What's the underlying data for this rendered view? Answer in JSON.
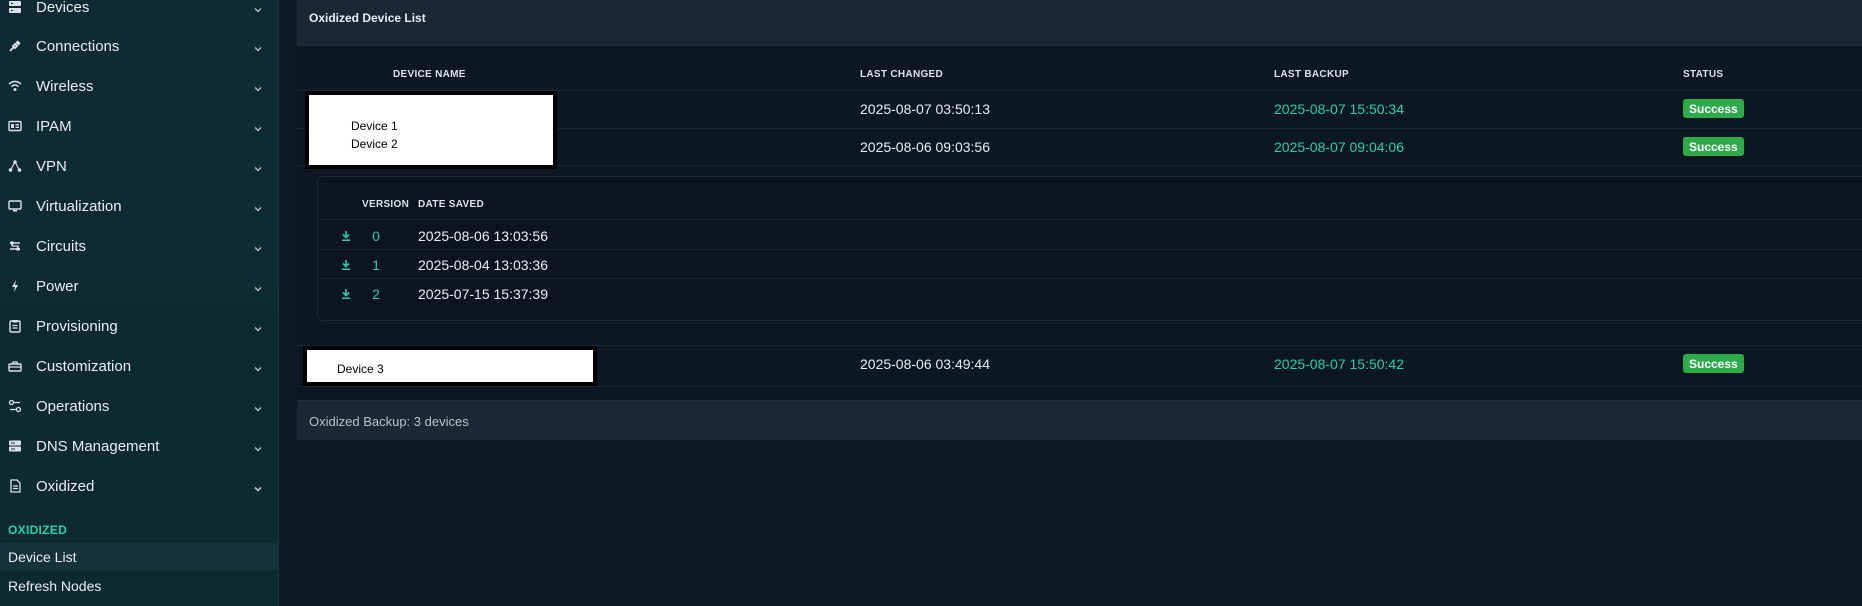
{
  "sidebar": {
    "items": [
      {
        "label": "Devices",
        "icon": "server-icon"
      },
      {
        "label": "Connections",
        "icon": "plug-icon"
      },
      {
        "label": "Wireless",
        "icon": "wifi-icon"
      },
      {
        "label": "IPAM",
        "icon": "ipam-icon"
      },
      {
        "label": "VPN",
        "icon": "vpn-icon"
      },
      {
        "label": "Virtualization",
        "icon": "monitor-icon"
      },
      {
        "label": "Circuits",
        "icon": "circuits-icon"
      },
      {
        "label": "Power",
        "icon": "bolt-icon"
      },
      {
        "label": "Provisioning",
        "icon": "clipboard-icon"
      },
      {
        "label": "Customization",
        "icon": "toolbox-icon"
      },
      {
        "label": "Operations",
        "icon": "operations-icon"
      },
      {
        "label": "DNS Management",
        "icon": "dns-icon"
      },
      {
        "label": "Oxidized",
        "icon": "file-icon"
      }
    ],
    "section_header": "OXIDIZED",
    "sub_items": [
      {
        "label": "Device List",
        "active": true
      },
      {
        "label": "Refresh Nodes",
        "active": false
      }
    ]
  },
  "card": {
    "title": "Oxidized Device List",
    "columns": [
      "DEVICE NAME",
      "LAST CHANGED",
      "LAST BACKUP",
      "STATUS"
    ],
    "rows": [
      {
        "name": "Device 1",
        "last_changed": "2025-08-07 03:50:13",
        "last_backup": "2025-08-07 15:50:34",
        "status": "Success"
      },
      {
        "name": "Device 2",
        "last_changed": "2025-08-06 09:03:56",
        "last_backup": "2025-08-07 09:04:06",
        "status": "Success"
      },
      {
        "name": "Device 3",
        "last_changed": "2025-08-06 03:49:44",
        "last_backup": "2025-08-07 15:50:42",
        "status": "Success"
      }
    ],
    "versions": {
      "columns": [
        "VERSION",
        "DATE SAVED"
      ],
      "rows": [
        {
          "version": "0",
          "date": "2025-08-06 13:03:56"
        },
        {
          "version": "1",
          "date": "2025-08-04 13:03:36"
        },
        {
          "version": "2",
          "date": "2025-07-15 15:37:39"
        }
      ]
    },
    "footer": "Oxidized Backup: 3 devices"
  },
  "colors": {
    "accent": "#23d1a3",
    "success_badge": "#2dab4b",
    "background": "#0e1b26"
  }
}
